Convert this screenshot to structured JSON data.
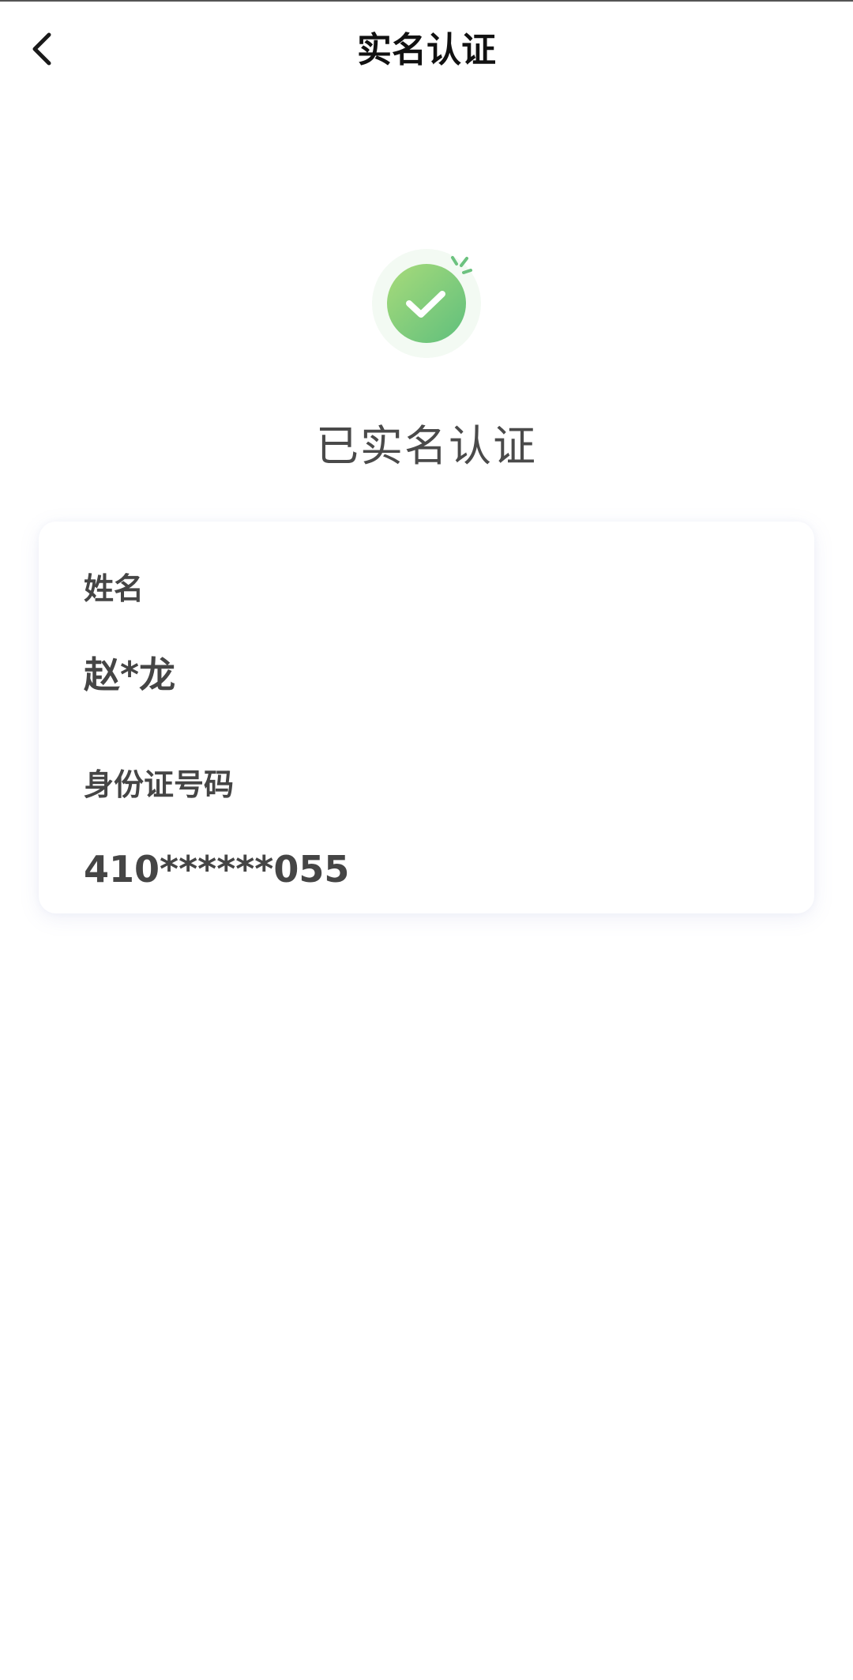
{
  "header": {
    "title": "实名认证",
    "back_icon": "chevron-left-icon"
  },
  "status": {
    "icon": "check-circle-icon",
    "text": "已实名认证",
    "colors": {
      "gradient_start": "#a8db7a",
      "gradient_end": "#5fbf7d",
      "halo": "#f3faf3",
      "sparkle": "#6cc27f"
    }
  },
  "card": {
    "name_label": "姓名",
    "name_value": "赵*龙",
    "id_label": "身份证号码",
    "id_value": "410******055"
  }
}
